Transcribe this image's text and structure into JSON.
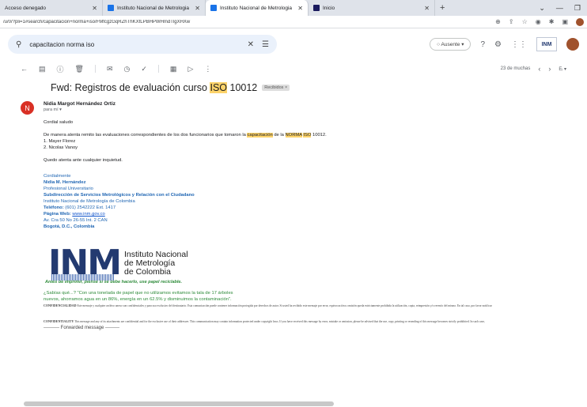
{
  "browser": {
    "tabs": [
      {
        "title": "Acceso denegado",
        "active": false
      },
      {
        "title": "Instituto Nacional de Metrologia",
        "active": false
      },
      {
        "title": "Instituto Nacional de Metrologia",
        "active": true
      },
      {
        "title": "Inicio",
        "active": false
      }
    ],
    "url": "/u/0/?pli=1#search/capacitacion+norma+iso/FMfcgzGqRZhThKXfLPBHPWHmdTlgXHXw"
  },
  "gmail": {
    "search_value": "capacitacion norma iso",
    "status": "Ausente",
    "pager": "23 de muchas",
    "subject": {
      "prefix": "Fwd: Registros de evaluación curso ",
      "highlight": "ISO",
      "suffix": " 10012",
      "label": "Recibidos"
    }
  },
  "message": {
    "sender_initial": "N",
    "sender_name": "Nidia Margot Hernández Ortiz",
    "to": "para mí",
    "greeting": "Cordial saludo",
    "intro_a": "De manera atenta remito las evaluaciones correspondientes de los dos  funcionarios que tomaron la ",
    "intro_hl1": "capacitación",
    "intro_b": " de la ",
    "intro_hl2": "NORMA",
    "intro_c": " ",
    "intro_hl3": "ISO",
    "intro_d": " 10012.",
    "list": [
      "1. Mayer Florez",
      "2. Nicolas Vanoy"
    ],
    "closing": "Quedo atenta ante cualquier inquietud.",
    "signature": {
      "cordially": "Cordialmente",
      "name": "Nidia M. Hernández",
      "role": "Profesional Universitario",
      "department": "Subdirección de Servicios Metrológicos y  Relación con el Ciudadano",
      "institute": "Instituto Nacional de Metrología de Colombia",
      "phone_label": "Teléfono:",
      "phone": " (601) 2542222 Ext. 1417",
      "web_label": "Página Web:",
      "web": "www.inm.gov.co",
      "address": "Av. Cra 50 No 26-55 Int. 2 CAN",
      "city": "Bogotá, D.C., Colombia"
    },
    "logo": {
      "mark": "INM",
      "line1": "Instituto Nacional",
      "line2": "de Metrología",
      "line3": "de Colombia"
    },
    "eco_note": "Antes de imprimir, piense si se debe hacerlo, use papel reciclable.",
    "eco_text1": "¿Sabías qué...? \"Con una tonelada de papel que no utilizamos evitamos la tala de 17 árboles",
    "eco_text2": "nuevos, ahorramos agua en un 86%, energía en un 62.5% y disminuimos la contaminación\".",
    "conf_es_label": "CONFIDENCIALIDAD",
    "conf_es_text": " Este mensaje y cualquier archivo anexo son confidenciales y para uso exclusivo del destinatario. Esta comunicación puede contener información protegida por derechos de autor. Si usted ha recibido este mensaje por error, equivocación u omisión queda estrictamente prohibida la utilización, copia, reimpresión y/o reenvío del mismo. En tal caso, por favor notificar",
    "conf_en_label": "CONFIDENTIALITY",
    "conf_en_text": " This message and any of its attachments are confidential and for the exclusive use of their addressee. This communication may contain information protected under copyright laws. If you have received this message by error, mistake or omission, please be advised that the use, copy, printing or resending of this message becomes strictly prohibited. In such case,",
    "forwarded": "---------- Forwarded message ---------"
  }
}
